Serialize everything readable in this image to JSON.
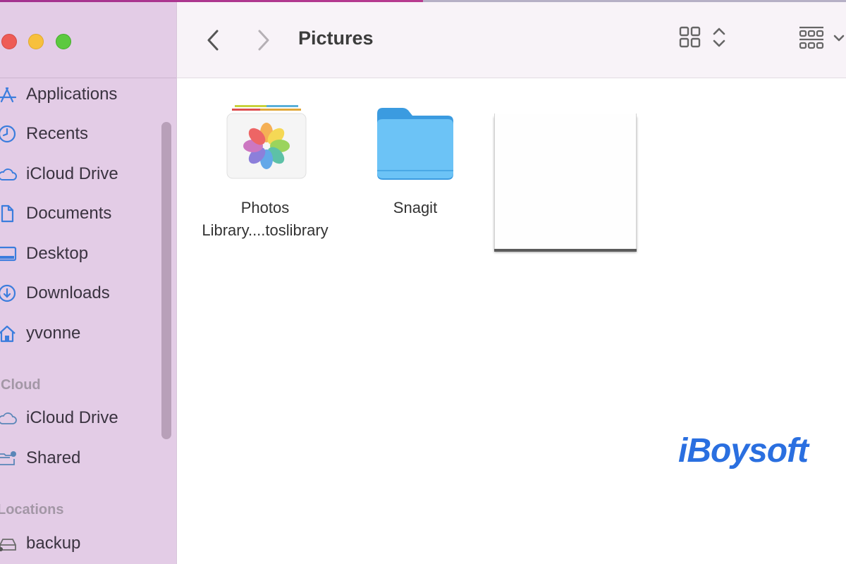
{
  "window": {
    "title": "Pictures",
    "traffic_lights": {
      "close": "#ee5c56",
      "minimize": "#f7c03d",
      "zoom": "#5cc93f"
    }
  },
  "toolbar": {
    "back_icon": "chevron-left-icon",
    "forward_icon": "chevron-right-icon",
    "view_icon": "icon-grid-view-icon",
    "view_toggle_icon": "up-down-chevron-icon",
    "group_icon": "group-by-icon",
    "group_dropdown_icon": "chevron-down-icon"
  },
  "sidebar": {
    "favorites": [
      {
        "label": "Applications",
        "icon": "app-store-icon"
      },
      {
        "label": "Recents",
        "icon": "clock-icon"
      },
      {
        "label": "iCloud Drive",
        "icon": "cloud-icon"
      },
      {
        "label": "Documents",
        "icon": "document-icon"
      },
      {
        "label": "Desktop",
        "icon": "desktop-icon"
      },
      {
        "label": "Downloads",
        "icon": "download-icon"
      },
      {
        "label": "yvonne",
        "icon": "home-icon"
      }
    ],
    "cloud_header": "Cloud",
    "cloud": [
      {
        "label": "iCloud Drive",
        "icon": "cloud-icon"
      },
      {
        "label": "Shared",
        "icon": "shared-folder-icon"
      }
    ],
    "locations_header": "Locations",
    "locations": [
      {
        "label": "backup",
        "icon": "drive-icon"
      }
    ]
  },
  "files": [
    {
      "name_line1": "Photos",
      "name_line2": "Library....toslibrary",
      "icon": "photos-library-icon"
    },
    {
      "name_line1": "Snagit",
      "icon": "folder-icon"
    },
    {
      "name_line1": "",
      "icon": "blank-document-thumbnail"
    }
  ],
  "watermark": "iBoysoft",
  "colors": {
    "sidebar_bg": "#e3cce6",
    "accent_icon": "#3b7ddd",
    "folder_blue": "#5bb9f4",
    "brand_blue": "#2a6fe0"
  }
}
